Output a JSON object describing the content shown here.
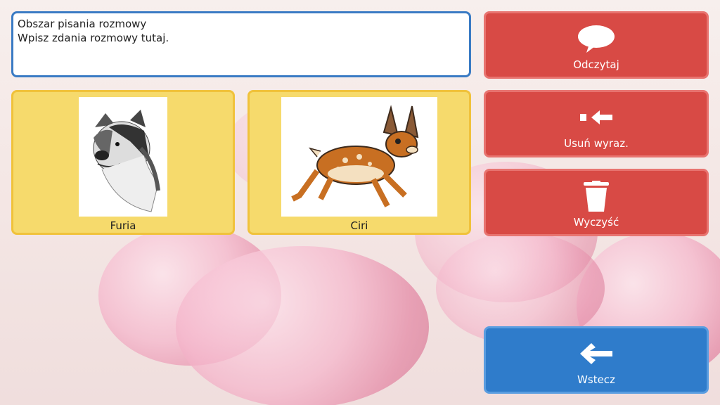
{
  "conversation": {
    "title": "Obszar pisania rozmowy",
    "hint": "Wpisz zdania rozmowy tutaj."
  },
  "tiles": [
    {
      "label": "Furia",
      "image": "border-collie-dog-drawing"
    },
    {
      "label": "Ciri",
      "image": "cartoon-fawn-deer"
    }
  ],
  "actions": {
    "speak": {
      "label": "Odczytaj",
      "icon": "speech-bubble-icon"
    },
    "delete_word": {
      "label": "Usuń wyraz.",
      "icon": "backspace-arrow-icon"
    },
    "clear": {
      "label": "Wyczyść",
      "icon": "trash-icon"
    },
    "back": {
      "label": "Wstecz",
      "icon": "arrow-left-icon"
    }
  },
  "colors": {
    "action_red": "#d84a45",
    "back_blue": "#2f7ccb",
    "tile_yellow": "#f6da6c",
    "input_border": "#3a7bc4"
  }
}
